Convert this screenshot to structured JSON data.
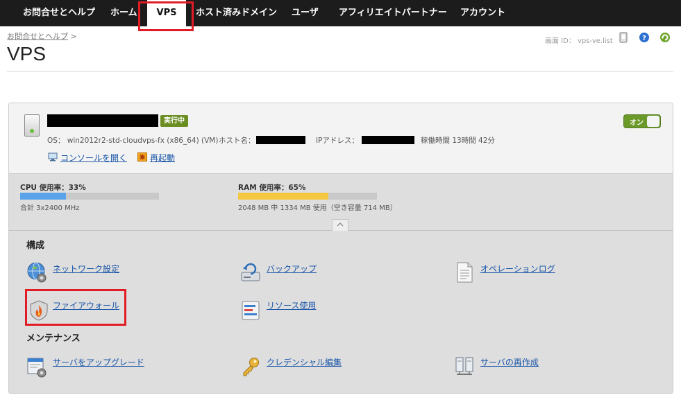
{
  "nav": {
    "items": [
      {
        "label": "お問合せとヘルプ"
      },
      {
        "label": "ホーム"
      },
      {
        "label": "VPS"
      },
      {
        "label": "ホスト済みドメイン"
      },
      {
        "label": "ユーザ"
      },
      {
        "label": "アフィリエイトパートナー"
      },
      {
        "label": "アカウント"
      }
    ]
  },
  "breadcrumb": {
    "link": "お問合せとヘルプ",
    "sep": ">"
  },
  "page": {
    "title": "VPS",
    "screen_id": "画面 ID： vps-ve.list"
  },
  "server": {
    "status_badge": "実行中",
    "power_toggle": "オン",
    "os": "OS： win2012r2-std-cloudvps-fx (x86_64) (VM)",
    "host_label": "ホスト名：",
    "ip_label": "IPアドレス：",
    "uptime": "稼働時間 13時間 42分",
    "console_link": "コンソールを開く",
    "restart_link": "再起動"
  },
  "usage": {
    "cpu": {
      "label": "CPU 使用率：33%",
      "percent": 33,
      "detail": "合計 3x2400 MHz",
      "color": "#5ba3e8"
    },
    "ram": {
      "label": "RAM 使用率：65%",
      "percent": 65,
      "detail": "2048 MB 中 1334 MB 使用（空き容量 714 MB）",
      "color": "#f5c842"
    }
  },
  "sections": {
    "config": {
      "heading": "構成",
      "items": [
        {
          "label": "ネットワーク設定",
          "icon": "network-globe-icon"
        },
        {
          "label": "バックアップ",
          "icon": "backup-drive-icon"
        },
        {
          "label": "オペレーションログ",
          "icon": "operation-log-icon"
        },
        {
          "label": "ファイアウォール",
          "icon": "firewall-shield-icon"
        },
        {
          "label": "リソース使用",
          "icon": "resource-usage-icon"
        }
      ]
    },
    "maintenance": {
      "heading": "メンテナンス",
      "items": [
        {
          "label": "サーバをアップグレード",
          "icon": "server-upgrade-icon"
        },
        {
          "label": "クレデンシャル編集",
          "icon": "key-icon"
        },
        {
          "label": "サーバの再作成",
          "icon": "server-recreate-icon"
        }
      ]
    }
  },
  "colors": {
    "highlight": "#e11c24",
    "link": "#1a56a8",
    "badge": "#6b8e23"
  }
}
